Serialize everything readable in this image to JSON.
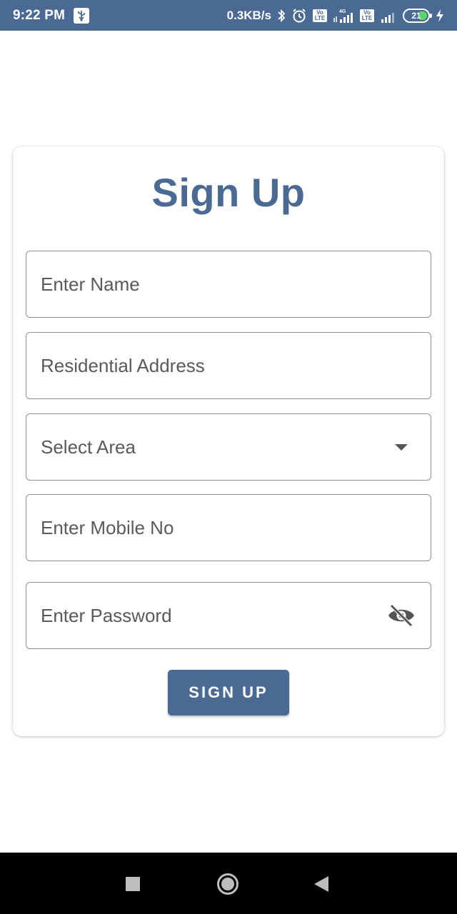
{
  "status_bar": {
    "time": "9:22 PM",
    "net_speed": "0.3KB/s",
    "volte": "Vo LTE",
    "network_4g": "4G",
    "battery": "21",
    "icons": [
      "usb-icon",
      "bluetooth-icon",
      "alarm-icon",
      "volte-icon",
      "signal-icon",
      "battery-icon",
      "charging-icon"
    ]
  },
  "form": {
    "title": "Sign Up",
    "name_placeholder": "Enter Name",
    "address_placeholder": "Residential Address",
    "area_placeholder": "Select Area",
    "mobile_placeholder": "Enter Mobile No",
    "password_placeholder": "Enter Password",
    "submit_label": "SIGN UP"
  },
  "colors": {
    "brand": "#4a6a94",
    "field_border": "#8f8f8f",
    "placeholder_text": "#5a5a5a"
  },
  "nav_bar": {
    "icons": [
      "recents-square-icon",
      "home-circle-icon",
      "back-triangle-icon"
    ]
  }
}
